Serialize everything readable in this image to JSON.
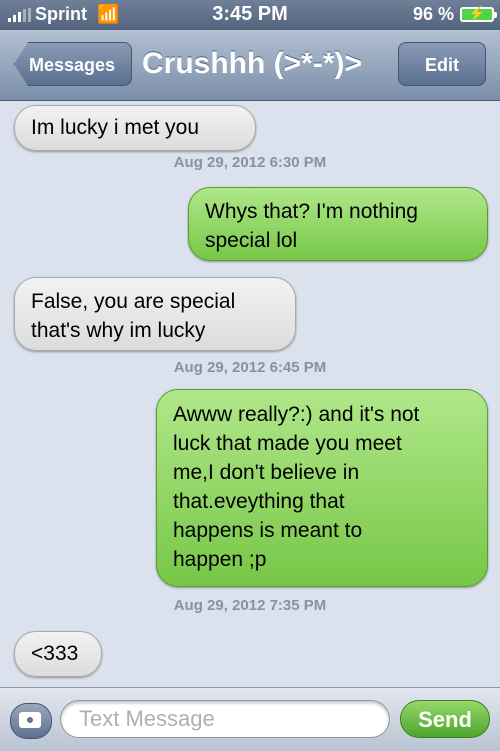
{
  "status_bar": {
    "carrier": "Sprint",
    "time": "3:45 PM",
    "battery_percent": "96 %",
    "signal_icon": "signal-bars-icon",
    "wifi_icon": "wifi-icon",
    "battery_icon": "battery-charging-icon"
  },
  "nav": {
    "back_label": "Messages",
    "title": "Crushhh (>*-*)>",
    "edit_label": "Edit"
  },
  "messages": [
    {
      "direction": "incoming",
      "text": "Im lucky i met you"
    },
    {
      "type": "timestamp",
      "text": "Aug 29, 2012 6:30 PM"
    },
    {
      "direction": "outgoing",
      "lines": [
        "Whys that? I'm nothing",
        "special lol"
      ]
    },
    {
      "direction": "incoming",
      "lines": [
        "False, you are special",
        "that's why im lucky"
      ]
    },
    {
      "type": "timestamp",
      "text": "Aug 29, 2012 6:45 PM"
    },
    {
      "direction": "outgoing",
      "lines": [
        "Awww really?:) and it's not",
        "luck that made you meet",
        "me,I don't believe in",
        "that.eveything that",
        "happens is meant to",
        "happen ;p"
      ]
    },
    {
      "type": "timestamp",
      "text": "Aug 29, 2012 7:35 PM"
    },
    {
      "direction": "incoming",
      "text": "<333"
    }
  ],
  "input_bar": {
    "camera_icon": "camera-icon",
    "placeholder": "Text Message",
    "value": "",
    "send_label": "Send"
  },
  "colors": {
    "incoming_bubble": "#e6e6e6",
    "outgoing_bubble": "#8dd45f",
    "background": "#dbe2ed",
    "nav_bar": "#8a9bb5"
  }
}
